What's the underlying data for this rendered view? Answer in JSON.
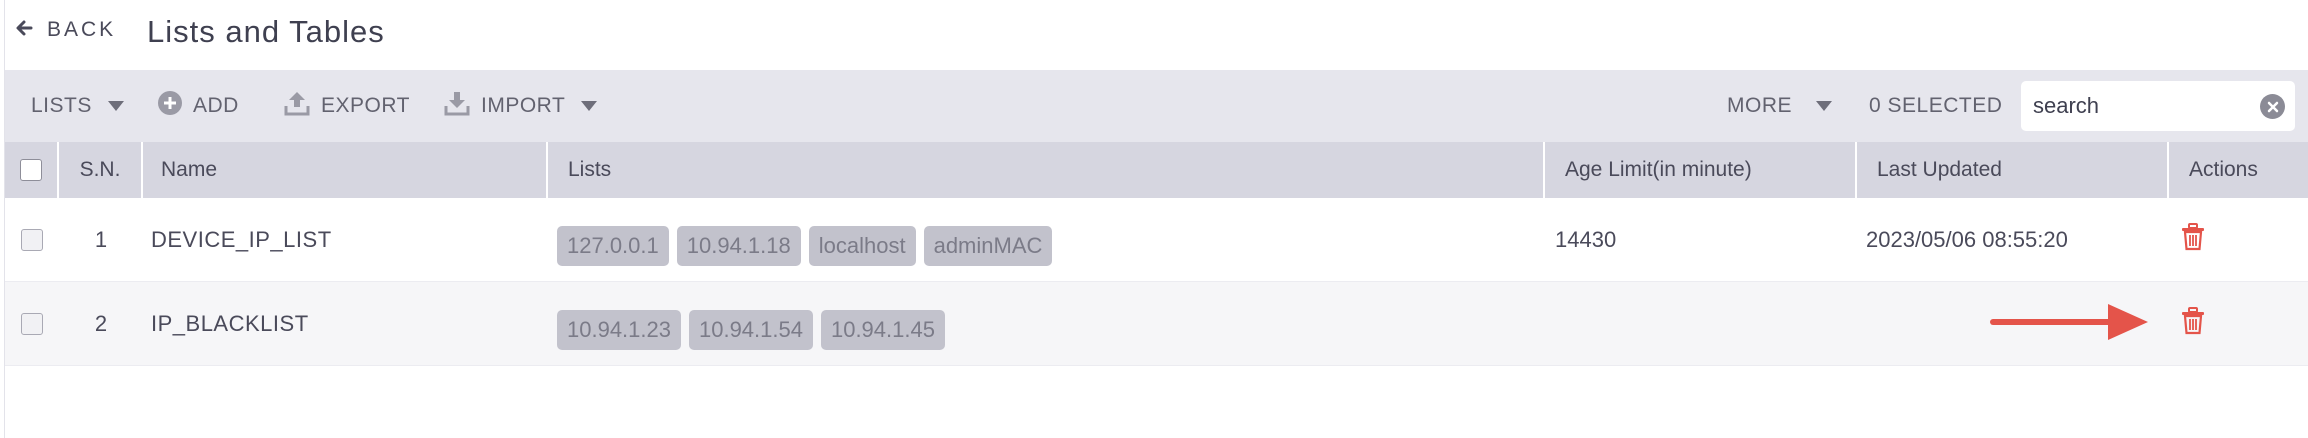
{
  "header": {
    "back_label": "BACK",
    "title": "Lists and Tables"
  },
  "toolbar": {
    "lists_label": "LISTS",
    "add_label": "ADD",
    "export_label": "EXPORT",
    "import_label": "IMPORT",
    "more_label": "MORE",
    "selected_label": "0 SELECTED",
    "search_value": "search"
  },
  "table": {
    "columns": {
      "sn": "S.N.",
      "name": "Name",
      "lists": "Lists",
      "age_limit": "Age Limit(in minute)",
      "last_updated": "Last Updated",
      "actions": "Actions"
    },
    "rows": [
      {
        "sn": "1",
        "name": "DEVICE_IP_LIST",
        "lists": [
          "127.0.0.1",
          "10.94.1.18",
          "localhost",
          "adminMAC"
        ],
        "age_limit": "14430",
        "last_updated": "2023/05/06 08:55:20"
      },
      {
        "sn": "2",
        "name": "IP_BLACKLIST",
        "lists": [
          "10.94.1.23",
          "10.94.1.54",
          "10.94.1.45"
        ],
        "age_limit": "",
        "last_updated": ""
      }
    ]
  },
  "colors": {
    "accent_red": "#e4544a",
    "toolbar_bg": "#e6e6ed",
    "header_bg": "#d6d6e0",
    "chip_bg": "#c2c2cc"
  },
  "icons": [
    "arrow-left-icon",
    "caret-down-icon",
    "plus-circle-icon",
    "upload-icon",
    "download-icon",
    "clear-icon",
    "trash-icon",
    "arrow-right-icon"
  ]
}
